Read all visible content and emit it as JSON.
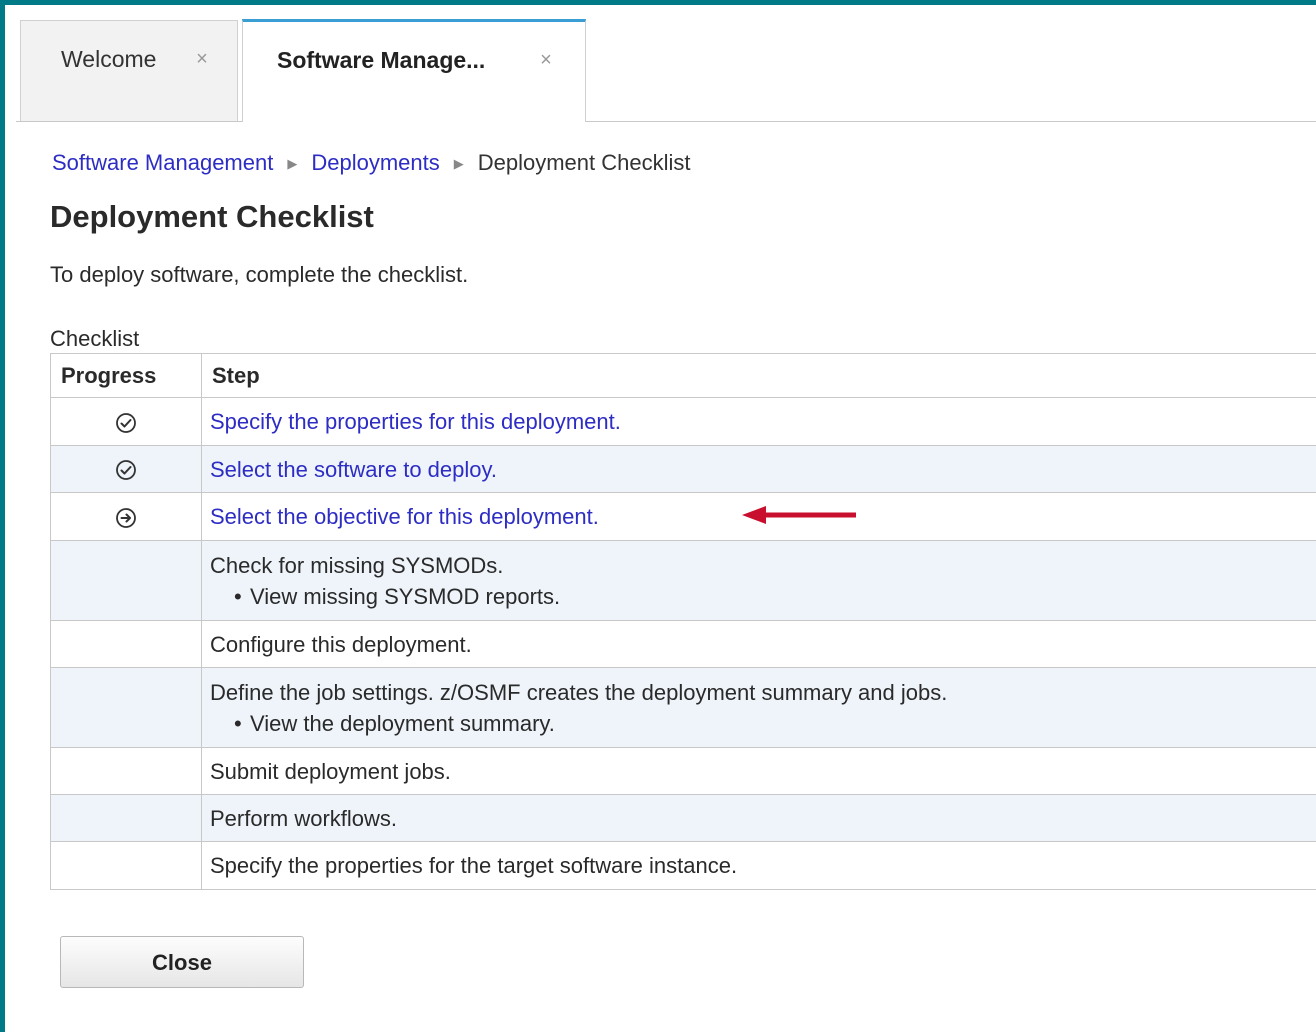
{
  "tabs": [
    {
      "label": "Welcome",
      "close_glyph": "×",
      "active": false
    },
    {
      "label": "Software Manage...",
      "close_glyph": "×",
      "active": true
    }
  ],
  "breadcrumb": {
    "items": [
      "Software Management",
      "Deployments"
    ],
    "current": "Deployment Checklist",
    "separator": "▶"
  },
  "page": {
    "title": "Deployment Checklist",
    "intro": "To deploy software, complete the checklist."
  },
  "checklist": {
    "caption": "Checklist",
    "headers": {
      "progress": "Progress",
      "step": "Step"
    },
    "rows": [
      {
        "status": "complete",
        "icon": "check-circle-icon",
        "text": "Specify the properties for this deployment.",
        "link": true,
        "sub": ""
      },
      {
        "status": "complete",
        "icon": "check-circle-icon",
        "text": "Select the software to deploy.",
        "link": true,
        "sub": ""
      },
      {
        "status": "current",
        "icon": "arrow-circle-icon",
        "text": "Select the objective for this deployment.",
        "link": true,
        "sub": ""
      },
      {
        "status": "",
        "icon": "",
        "text": "Check for missing SYSMODs.",
        "link": false,
        "sub": "View missing SYSMOD reports."
      },
      {
        "status": "",
        "icon": "",
        "text": "Configure this deployment.",
        "link": false,
        "sub": ""
      },
      {
        "status": "",
        "icon": "",
        "text": "Define the job settings. z/OSMF creates the deployment summary and jobs.",
        "link": false,
        "sub": "View the deployment summary."
      },
      {
        "status": "",
        "icon": "",
        "text": "Submit deployment jobs.",
        "link": false,
        "sub": ""
      },
      {
        "status": "",
        "icon": "",
        "text": "Perform workflows.",
        "link": false,
        "sub": ""
      },
      {
        "status": "",
        "icon": "",
        "text": "Specify the properties for the target software instance.",
        "link": false,
        "sub": ""
      }
    ]
  },
  "actions": {
    "close_label": "Close"
  },
  "colors": {
    "frame": "#007a87",
    "link": "#2d2dc4",
    "annotation_arrow": "#c8102e",
    "active_tab_accent": "#3a9ed4"
  }
}
